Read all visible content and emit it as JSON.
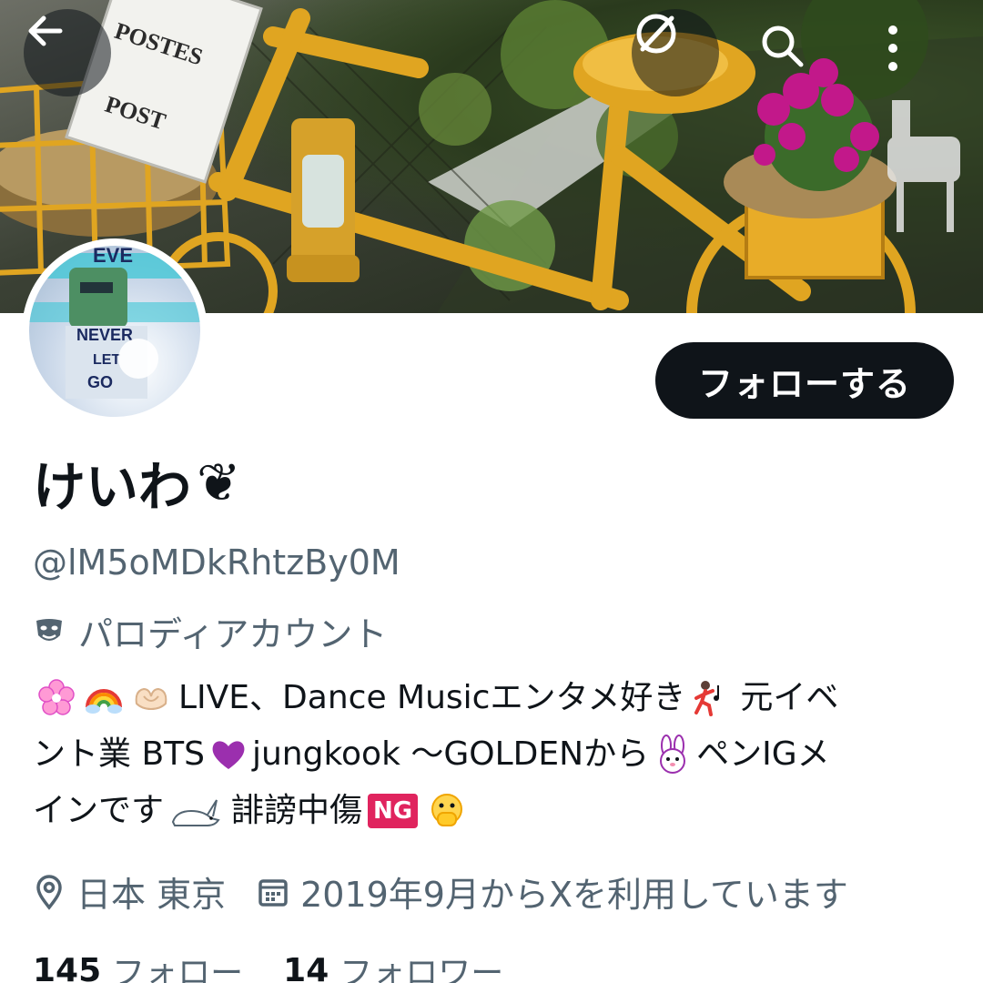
{
  "header": {
    "back_icon": "arrow-left-icon",
    "grok_icon": "grok-icon",
    "search_icon": "search-icon",
    "more_icon": "more-vertical-icon"
  },
  "banner": {
    "postbox_line1": "POSTES",
    "postbox_line2": "POST"
  },
  "avatar": {
    "text_top": "EVE",
    "text_mid": "NEVER",
    "text_low": "LET",
    "text_bottom": "GO"
  },
  "profile": {
    "follow_label": "フォローする",
    "display_name": "けいわ",
    "display_name_emoji": "❦",
    "handle": "@lM5oMDkRhtzBy0M",
    "parody_label": "パロディアカウント",
    "bio_line1_pre": "LIVE、Dance Musicエンタメ好き",
    "bio_line1_post": "元イベ",
    "bio_line2_pre": "ント業  BTS",
    "bio_line2_mid": "jungkook 〜GOLDENから",
    "bio_line2_post": "ペンIGメ",
    "bio_line3_pre": "インです",
    "bio_line3_mid": "誹謗中傷",
    "bio_ng": "NG",
    "location": "日本 東京",
    "joined": "2019年9月からXを利用しています",
    "following_count": "145",
    "following_label": "フォロー",
    "followers_count": "14",
    "followers_label": "フォロワー"
  },
  "colors": {
    "primary_text": "#0f1419",
    "secondary_text": "#536471",
    "banner_yellow": "#e0a521",
    "purple_heart": "#9b2fae",
    "ng_red": "#e0245e"
  }
}
